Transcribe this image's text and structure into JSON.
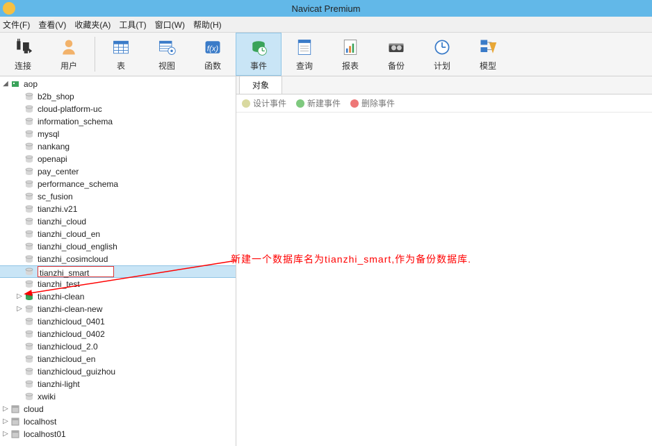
{
  "title": "Navicat Premium",
  "menu": {
    "file": "文件(F)",
    "view": "查看(V)",
    "fav": "收藏夹(A)",
    "tools": "工具(T)",
    "window": "窗口(W)",
    "help": "帮助(H)"
  },
  "toolbar": {
    "connect": "连接",
    "user": "用户",
    "table": "表",
    "view": "视图",
    "function": "函数",
    "event": "事件",
    "query": "查询",
    "report": "报表",
    "backup": "备份",
    "schedule": "计划",
    "model": "模型"
  },
  "tree": {
    "root": "aop",
    "items": [
      {
        "label": "b2b_shop",
        "state": "off"
      },
      {
        "label": "cloud-platform-uc",
        "state": "off"
      },
      {
        "label": "information_schema",
        "state": "off"
      },
      {
        "label": "mysql",
        "state": "off"
      },
      {
        "label": "nankang",
        "state": "off"
      },
      {
        "label": "openapi",
        "state": "off"
      },
      {
        "label": "pay_center",
        "state": "off"
      },
      {
        "label": "performance_schema",
        "state": "off"
      },
      {
        "label": "sc_fusion",
        "state": "off"
      },
      {
        "label": "tianzhi.v21",
        "state": "off"
      },
      {
        "label": "tianzhi_cloud",
        "state": "off"
      },
      {
        "label": "tianzhi_cloud_en",
        "state": "off"
      },
      {
        "label": "tianzhi_cloud_english",
        "state": "off"
      },
      {
        "label": "tianzhi_cosimcloud",
        "state": "off"
      },
      {
        "label": "tianzhi_smart",
        "state": "off",
        "selected": true
      },
      {
        "label": "tianzhi_test",
        "state": "off"
      },
      {
        "label": "tianzhi-clean",
        "state": "on",
        "arrow": true
      },
      {
        "label": "tianzhi-clean-new",
        "state": "off",
        "arrow": true
      },
      {
        "label": "tianzhicloud_0401",
        "state": "off"
      },
      {
        "label": "tianzhicloud_0402",
        "state": "off"
      },
      {
        "label": "tianzhicloud_2.0",
        "state": "off"
      },
      {
        "label": "tianzhicloud_en",
        "state": "off"
      },
      {
        "label": "tianzhicloud_guizhou",
        "state": "off"
      },
      {
        "label": "tianzhi-light",
        "state": "off"
      },
      {
        "label": "xwiki",
        "state": "off"
      }
    ],
    "servers": [
      {
        "label": "cloud"
      },
      {
        "label": "localhost"
      },
      {
        "label": "localhost01"
      }
    ]
  },
  "content": {
    "tab": "对象",
    "sub": {
      "design": "设计事件",
      "new": "新建事件",
      "delete": "删除事件"
    }
  },
  "annotation": "新建一个数据库名为tianzhi_smart,作为备份数据库."
}
